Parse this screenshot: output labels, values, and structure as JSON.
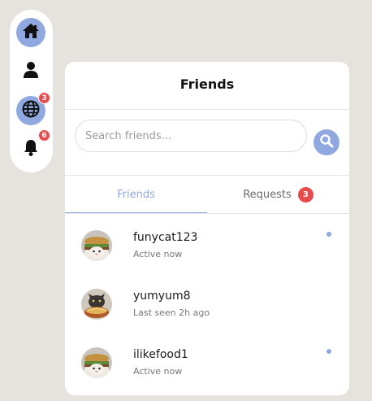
{
  "colors": {
    "accent": "#8fa8e0",
    "badge": "#e84b4b",
    "background": "#e6e2dd"
  },
  "rail": {
    "items": [
      {
        "icon": "home-icon",
        "active": true,
        "badge": ""
      },
      {
        "icon": "user-icon",
        "active": false,
        "badge": ""
      },
      {
        "icon": "globe-icon",
        "active": true,
        "badge": "3"
      },
      {
        "icon": "bell-icon",
        "active": false,
        "badge": "6"
      }
    ]
  },
  "panel": {
    "title": "Friends",
    "search": {
      "placeholder": "Search friends...",
      "value": "",
      "icon": "search-icon"
    },
    "tabs": [
      {
        "label": "Friends",
        "active": true,
        "badge": ""
      },
      {
        "label": "Requests",
        "active": false,
        "badge": "3"
      }
    ],
    "friends": [
      {
        "name": "funycat123",
        "status": "Active now",
        "online": true,
        "avatar": "cat-burger-avatar"
      },
      {
        "name": "yumyum8",
        "status": "Last seen 2h ago",
        "online": false,
        "avatar": "cat-noodles-avatar"
      },
      {
        "name": "ilikefood1",
        "status": "Active now",
        "online": true,
        "avatar": "cat-burger-avatar"
      }
    ]
  }
}
